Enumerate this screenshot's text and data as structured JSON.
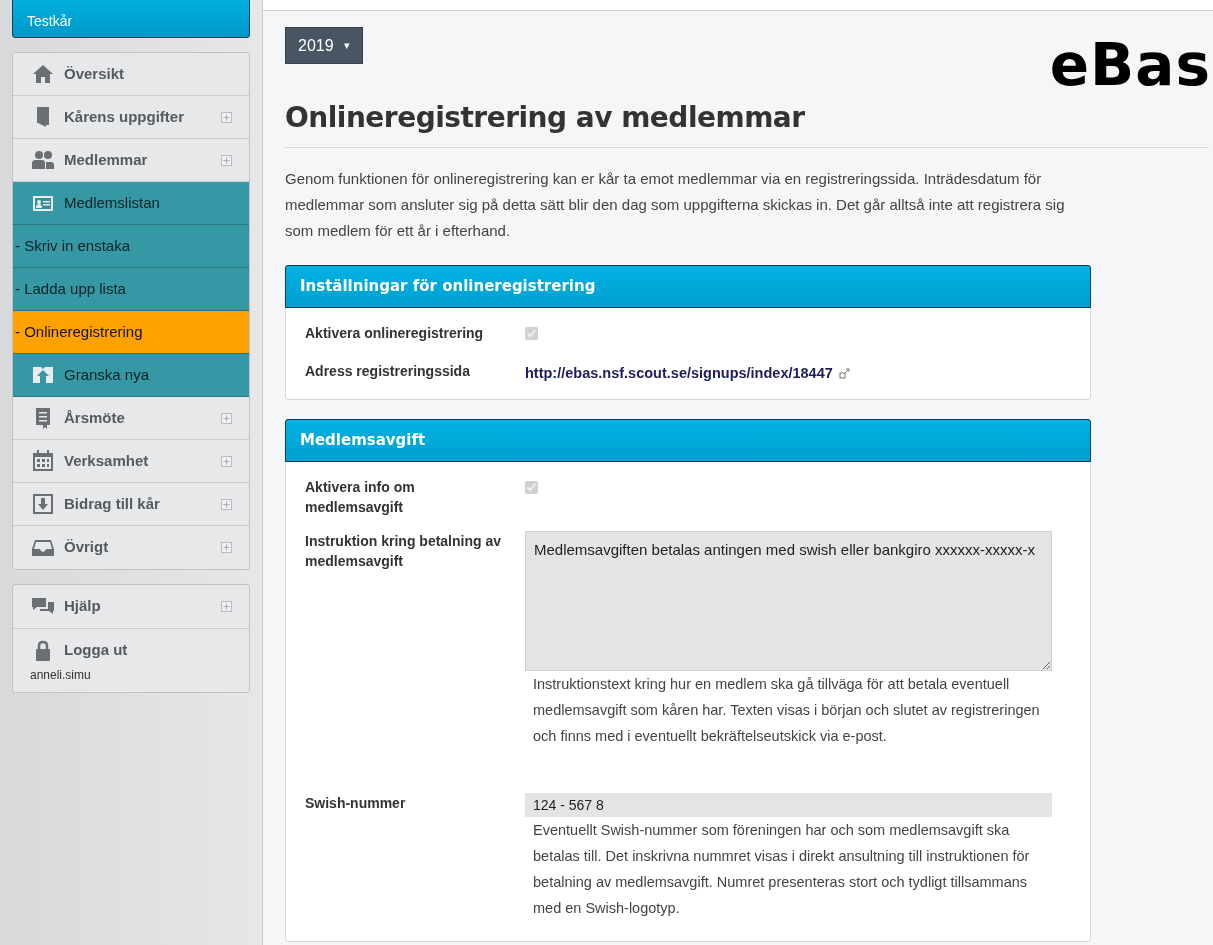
{
  "sidebar": {
    "organization": "Testkår",
    "menu": [
      {
        "kind": "group",
        "label": "Översikt",
        "expandable": false,
        "selected": false
      },
      {
        "kind": "group",
        "label": "Kårens uppgifter",
        "expandable": true,
        "selected": false
      },
      {
        "kind": "group",
        "label": "Medlemmar",
        "expandable": true,
        "selected": false
      },
      {
        "kind": "child",
        "label": "Medlemslistan",
        "selected": false
      },
      {
        "kind": "child",
        "label": "- Skriv in enstaka",
        "selected": false
      },
      {
        "kind": "child",
        "label": "- Ladda upp lista",
        "selected": false
      },
      {
        "kind": "child",
        "label": "- Onlineregistrering",
        "selected": true
      },
      {
        "kind": "child",
        "label": "Granska nya",
        "selected": false
      },
      {
        "kind": "group",
        "label": "Årsmöte",
        "expandable": true,
        "selected": false
      },
      {
        "kind": "group",
        "label": "Verksamhet",
        "expandable": true,
        "selected": false
      },
      {
        "kind": "group",
        "label": "Bidrag till kår",
        "expandable": true,
        "selected": false
      },
      {
        "kind": "group",
        "label": "Övrigt",
        "expandable": true,
        "selected": false
      }
    ],
    "footer_menu": [
      {
        "label": "Hjälp",
        "expandable": true
      },
      {
        "label": "Logga ut",
        "user": "anneli.simu"
      }
    ]
  },
  "year_select": {
    "value": "2019",
    "caret": "▾"
  },
  "logo": "eBas",
  "page_title": "Onlineregistrering av medlemmar",
  "intro": "Genom funktionen för onlineregistrering kan er kår ta emot medlemmar via en registreringssida. Inträdesdatum för medlemmar som ansluter sig på detta sätt blir den dag som uppgifterna skickas in. Det går alltså inte att registrera sig som medlem för ett år i efterhand.",
  "panels": [
    {
      "title": "Inställningar för onlineregistrering",
      "fields": [
        {
          "kind": "checkbox",
          "label": "Aktivera onlineregistrering",
          "checked": true
        },
        {
          "kind": "link",
          "label": "Adress registreringssida",
          "value": "http://ebas.nsf.scout.se/signups/index/18447"
        }
      ]
    },
    {
      "title": "Medlemsavgift",
      "fields": [
        {
          "kind": "checkbox",
          "label": "Aktivera info om medlemsavgift",
          "checked": true
        },
        {
          "kind": "textarea",
          "label": "Instruktion kring betalning av medlemsavgift",
          "value": "Medlemsavgiften betalas antingen med swish eller bankgiro xxxxxx-xxxxx-x",
          "help": "Instruktionstext kring hur en medlem ska gå tillväga för att betala eventuell medlemsavgift som kåren har. Texten visas i början och slutet av registreringen och finns med i eventuellt bekräftelseutskick via e-post."
        },
        {
          "kind": "input",
          "label": "Swish-nummer",
          "value": "124 - 567 8",
          "help": "Eventuellt Swish-nummer som föreningen har och som medlemsavgift ska betalas till. Det inskrivna nummret visas i direkt ansultning till instruktionen för betalning av medlemsavgift. Numret presenteras stort och tydligt tillsammans med en Swish-logotyp."
        }
      ]
    }
  ]
}
